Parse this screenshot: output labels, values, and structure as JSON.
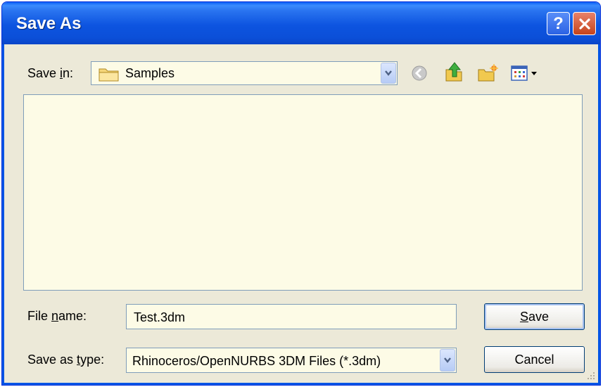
{
  "window": {
    "title": "Save As"
  },
  "titlebar": {
    "help_label": "?",
    "close_label": "✕"
  },
  "toolbar": {
    "save_in_prefix": "Save ",
    "save_in_access": "i",
    "save_in_suffix": "n:",
    "location_value": "Samples",
    "icons": [
      "folder-icon",
      "back-icon",
      "up-folder-icon",
      "new-folder-icon",
      "view-menu-icon"
    ]
  },
  "form": {
    "file_name_prefix": "File ",
    "file_name_access": "n",
    "file_name_suffix": "ame:",
    "file_name_value": "Test.3dm",
    "save_as_type_prefix": "Save as ",
    "save_as_type_access": "t",
    "save_as_type_suffix": "ype:",
    "save_as_type_value": "Rhinoceros/OpenNURBS 3DM Files (*.3dm)"
  },
  "buttons": {
    "save_access": "S",
    "save_rest": "ave",
    "cancel_label": "Cancel"
  },
  "colors": {
    "titlebar": "#0b4fd8",
    "dialog_bg": "#ece9d8",
    "list_bg": "#fdfbe6"
  }
}
